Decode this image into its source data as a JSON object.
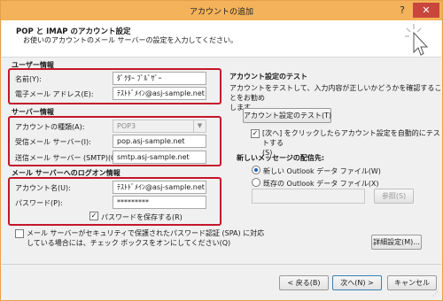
{
  "window": {
    "title": "アカウントの追加",
    "help_glyph": "?",
    "close_glyph": "✕"
  },
  "header": {
    "title": "POP と IMAP のアカウント設定",
    "subtitle": "お使いのアカウントのメール サーバーの設定を入力してください。"
  },
  "user_info": {
    "section_label": "ユーザー情報",
    "name_label": "名前(Y):",
    "name_value": "ﾀﾞｸﾀｰ ﾌﾞﾙﾞｻﾞｰ",
    "email_label": "電子メール アドレス(E):",
    "email_value": "ﾃｽﾄﾄﾞﾒｲﾝ@asj-sample.net"
  },
  "server_info": {
    "section_label": "サーバー情報",
    "account_type_label": "アカウントの種類(A):",
    "account_type_value": "POP3",
    "incoming_label": "受信メール サーバー(I):",
    "incoming_value": "pop.asj-sample.net",
    "outgoing_label": "送信メール サーバー (SMTP)(O):",
    "outgoing_value": "smtp.asj-sample.net"
  },
  "logon_info": {
    "section_label": "メール サーバーへのログオン情報",
    "account_name_label": "アカウント名(U):",
    "account_name_value": "ﾃｽﾄﾄﾞﾒｲﾝ@asj-sample.net",
    "password_label": "パスワード(P):",
    "password_value": "*********",
    "remember_label": "パスワードを保存する(R)",
    "remember_checked": true,
    "spa_label_line1": "メール サーバーがセキュリティで保護されたパスワード認証 (SPA) に対応",
    "spa_label_line2": "している場合には、チェック ボックスをオンにしてください(Q)",
    "spa_checked": false
  },
  "test": {
    "section_label": "アカウント設定のテスト",
    "description_line1": "アカウントをテストして、入力内容が正しいかどうかを確認することをお勧め",
    "description_line2": "します。",
    "test_button": "アカウント設定のテスト(T)",
    "auto_test_line1": "[次へ] をクリックしたらアカウント設定を自動的にテストする",
    "auto_test_line2": "(S)",
    "auto_test_checked": true
  },
  "delivery": {
    "section_label": "新しいメッセージの配信先:",
    "new_file_label": "新しい Outlook データ ファイル(W)",
    "existing_file_label": "既存の Outlook データ ファイル(X)",
    "selected": "new",
    "browse_button": "参照(S)"
  },
  "buttons": {
    "more_settings": "詳細設定(M)...",
    "back": "< 戻る(B)",
    "next": "次へ(N) >",
    "cancel": "キャンセル"
  },
  "icons": {
    "check": "✓",
    "dropdown": "▼",
    "grip": "⋰"
  }
}
